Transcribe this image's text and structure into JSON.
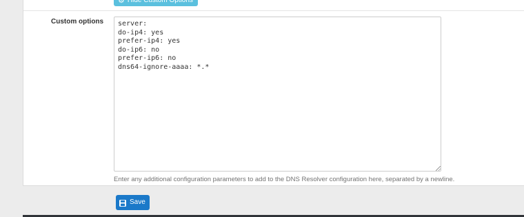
{
  "colors": {
    "page_bg": "#ececec",
    "panel_bg": "#ffffff",
    "info_button": "#5bc0de",
    "primary_button": "#1b79c9",
    "footer": "#2f3237"
  },
  "toggle_button": {
    "label": "Hide Custom Options",
    "icon": "cog-icon"
  },
  "custom_options": {
    "label": "Custom options",
    "value": "server:\ndo-ip4: yes\nprefer-ip4: yes\ndo-ip6: no\nprefer-ip6: no\ndns64-ignore-aaaa: *.*",
    "help_text": "Enter any additional configuration parameters to add to the DNS Resolver configuration here, separated by a newline."
  },
  "save_button": {
    "label": "Save",
    "icon": "floppy-disk-icon"
  }
}
